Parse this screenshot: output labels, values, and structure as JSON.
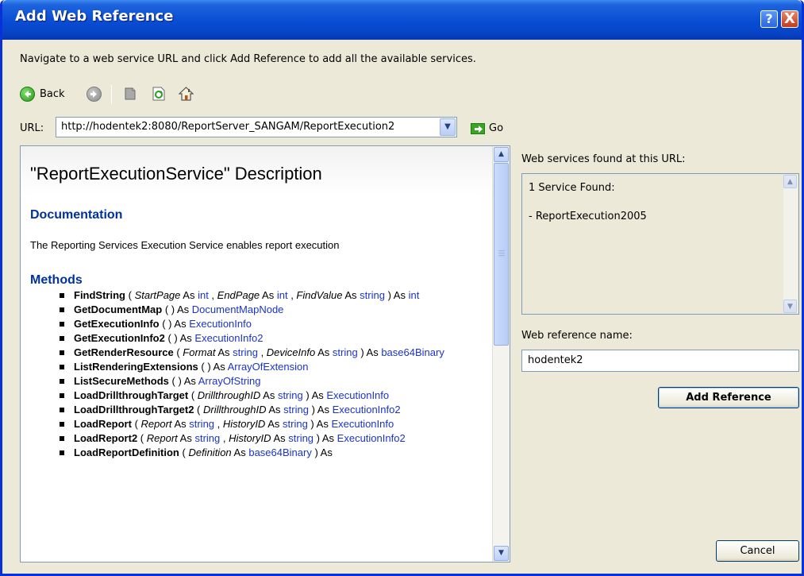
{
  "window": {
    "title": "Add Web Reference",
    "help_label": "?",
    "close_label": "X"
  },
  "instruction": "Navigate to a web service URL and click Add Reference to add all the available services.",
  "toolbar": {
    "back_label": "Back"
  },
  "url": {
    "label": "URL:",
    "value": "http://hodentek2:8080/ReportServer_SANGAM/ReportExecution2",
    "go_label": "Go"
  },
  "description": {
    "title": "\"ReportExecutionService\" Description",
    "documentation_heading": "Documentation",
    "documentation_text": "The Reporting Services Execution Service enables report execution",
    "methods_heading": "Methods",
    "methods": [
      {
        "name": "FindString",
        "sig": [
          [
            "(",
            "p"
          ],
          [
            " StartPage",
            "i"
          ],
          [
            " As ",
            "p"
          ],
          [
            "int",
            "t"
          ],
          [
            " ,  ",
            "p"
          ],
          [
            "EndPage",
            "i"
          ],
          [
            " As ",
            "p"
          ],
          [
            "int",
            "t"
          ],
          [
            " ,  ",
            "p"
          ],
          [
            "FindValue",
            "i"
          ],
          [
            " As ",
            "p"
          ],
          [
            "string",
            "t"
          ],
          [
            " ) As ",
            "p"
          ],
          [
            "int",
            "t"
          ]
        ]
      },
      {
        "name": "GetDocumentMap",
        "sig": [
          [
            "( ) As ",
            "p"
          ],
          [
            "DocumentMapNode",
            "t"
          ]
        ]
      },
      {
        "name": "GetExecutionInfo",
        "sig": [
          [
            "( ) As ",
            "p"
          ],
          [
            "ExecutionInfo",
            "t"
          ]
        ]
      },
      {
        "name": "GetExecutionInfo2",
        "sig": [
          [
            "( ) As ",
            "p"
          ],
          [
            "ExecutionInfo2",
            "t"
          ]
        ]
      },
      {
        "name": "GetRenderResource",
        "sig": [
          [
            "(",
            "p"
          ],
          [
            " Format",
            "i"
          ],
          [
            " As ",
            "p"
          ],
          [
            "string",
            "t"
          ],
          [
            " ,  ",
            "p"
          ],
          [
            "DeviceInfo",
            "i"
          ],
          [
            " As ",
            "p"
          ],
          [
            "string",
            "t"
          ],
          [
            " ) As ",
            "p"
          ],
          [
            "base64Binary",
            "t"
          ]
        ]
      },
      {
        "name": "ListRenderingExtensions",
        "sig": [
          [
            "( ) As ",
            "p"
          ],
          [
            "ArrayOfExtension",
            "t"
          ]
        ]
      },
      {
        "name": "ListSecureMethods",
        "sig": [
          [
            "( ) As ",
            "p"
          ],
          [
            "ArrayOfString",
            "t"
          ]
        ]
      },
      {
        "name": "LoadDrillthroughTarget",
        "sig": [
          [
            "(",
            "p"
          ],
          [
            " DrillthroughID",
            "i"
          ],
          [
            " As ",
            "p"
          ],
          [
            "string",
            "t"
          ],
          [
            " ) As ",
            "p"
          ],
          [
            "ExecutionInfo",
            "t"
          ]
        ]
      },
      {
        "name": "LoadDrillthroughTarget2",
        "sig": [
          [
            "(",
            "p"
          ],
          [
            " DrillthroughID",
            "i"
          ],
          [
            " As ",
            "p"
          ],
          [
            "string",
            "t"
          ],
          [
            " ) As ",
            "p"
          ],
          [
            "ExecutionInfo2",
            "t"
          ]
        ]
      },
      {
        "name": "LoadReport",
        "sig": [
          [
            "(",
            "p"
          ],
          [
            " Report",
            "i"
          ],
          [
            " As ",
            "p"
          ],
          [
            "string",
            "t"
          ],
          [
            " ,  ",
            "p"
          ],
          [
            "HistoryID",
            "i"
          ],
          [
            " As ",
            "p"
          ],
          [
            "string",
            "t"
          ],
          [
            " ) As ",
            "p"
          ],
          [
            "ExecutionInfo",
            "t"
          ]
        ]
      },
      {
        "name": "LoadReport2",
        "sig": [
          [
            "(",
            "p"
          ],
          [
            " Report",
            "i"
          ],
          [
            " As ",
            "p"
          ],
          [
            "string",
            "t"
          ],
          [
            " ,  ",
            "p"
          ],
          [
            "HistoryID",
            "i"
          ],
          [
            " As ",
            "p"
          ],
          [
            "string",
            "t"
          ],
          [
            " ) As ",
            "p"
          ],
          [
            "ExecutionInfo2",
            "t"
          ]
        ]
      },
      {
        "name": "LoadReportDefinition",
        "sig": [
          [
            "(",
            "p"
          ],
          [
            " Definition",
            "i"
          ],
          [
            " As ",
            "p"
          ],
          [
            "base64Binary",
            "t"
          ],
          [
            " ) As",
            "p"
          ]
        ]
      }
    ]
  },
  "services": {
    "label": "Web services found at this URL:",
    "count_text": "1 Service Found:",
    "items": [
      "- ReportExecution2005"
    ]
  },
  "reference": {
    "label": "Web reference name:",
    "value": "hodentek2",
    "add_label": "Add Reference",
    "cancel_label": "Cancel"
  }
}
